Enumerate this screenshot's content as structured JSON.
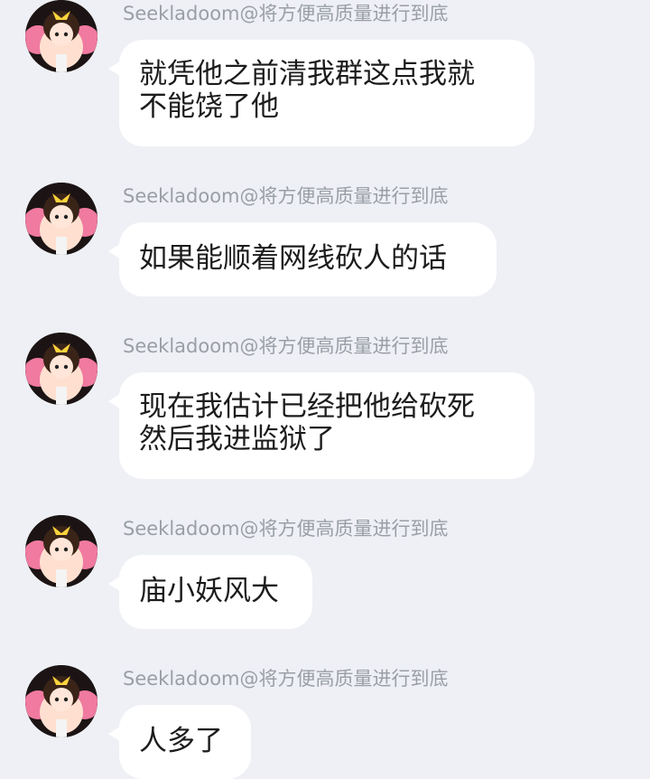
{
  "messages": [
    {
      "sender": "Seekladoom@将方便高质量进行到底",
      "text": "就凭他之前清我群这点我就\n不能饶了他"
    },
    {
      "sender": "Seekladoom@将方便高质量进行到底",
      "text": "如果能顺着网线砍人的话"
    },
    {
      "sender": "Seekladoom@将方便高质量进行到底",
      "text": "现在我估计已经把他给砍死\n然后我进监狱了"
    },
    {
      "sender": "Seekladoom@将方便高质量进行到底",
      "text": "庙小妖风大"
    },
    {
      "sender": "Seekladoom@将方便高质量进行到底",
      "text": "人多了"
    }
  ],
  "avatar": {
    "icon": "anime-girl-avatar-icon"
  },
  "colors": {
    "background": "#eef0f5",
    "bubble": "#ffffff",
    "sender_text": "#9a9ea6",
    "message_text": "#1c1c1c"
  }
}
